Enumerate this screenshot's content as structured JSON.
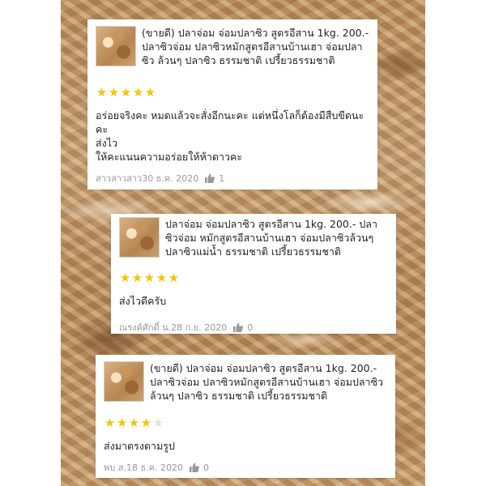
{
  "colors": {
    "star_on": "#f5c400",
    "star_off": "#e3e3e3",
    "meta": "#999999",
    "text": "#222222"
  },
  "reviews": [
    {
      "product_name": "(ขายดี) ปลาจ่อม  จ่อมปลาซิว สูตรอีสาน 1kg. 200.- ปลาซิวจ่อม ปลาซิวหมักสูตรอีสานบ้านเฮา จ่อมปลาซิว ล้วนๆ ปลาซิว ธรรมชาติ เปรี้ยวธรรมชาติ",
      "rating": 5,
      "text": "อร่อยจริงคะ หมดแล้วจะสั่งอีกนะคะ แต่หนึ่งโลก็ต้องมีสืบขีดนะคะ\nส่งไว\nให้คะแนนความอร่อยให้ห้าดาวคะ",
      "user": "สาวสาวสาว",
      "date": "30 ธ.ค. 2020",
      "likes": "1"
    },
    {
      "product_name": "ปลาจ่อม  จ่อมปลาซิว สูตรอีสาน 1kg. 200.- ปลาซิวจ่อม หมักสูตรอีสานบ้านเฮา จ่อมปลาซิวล้วนๆ ปลาซิวแม่น้ำ ธรรมชาติ เปรี้ยวธรรมชาติ",
      "rating": 5,
      "text": "ส่งไวดีครับ",
      "user": "ณรงค์ศักดิ์ น.",
      "date": "28 ก.ย. 2020",
      "likes": "0"
    },
    {
      "product_name": "(ขายดี) ปลาจ่อม  จ่อมปลาซิว สูตรอีสาน 1kg. 200.- ปลาซิวจ่อม ปลาซิวหมักสูตรอีสานบ้านเฮา จ่อมปลาซิว ล้วนๆ ปลาซิว ธรรมชาติ เปรี้ยวธรรมชาติ",
      "rating": 4,
      "text": "ส่งมาตรงตามรูป",
      "user": "พบ ส.",
      "date": "18 ธ.ค. 2020",
      "likes": "0"
    }
  ]
}
